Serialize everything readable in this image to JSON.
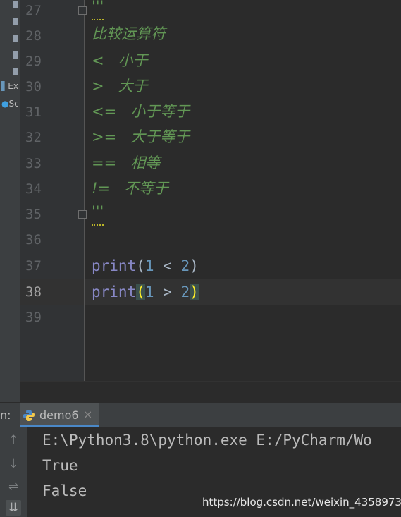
{
  "project_strip": [
    "Ex",
    "Sc"
  ],
  "line_numbers": [
    "27",
    "28",
    "29",
    "30",
    "31",
    "32",
    "33",
    "34",
    "35",
    "36",
    "37",
    "38",
    "39"
  ],
  "code": {
    "l27": "'''",
    "l28": "比较运算符",
    "l29": "<   小于",
    "l30": ">   大于",
    "l31": "<=   小于等于",
    "l32": ">=   大于等于",
    "l33": "==   相等",
    "l34": "!=   不等于",
    "l35": "'''",
    "l37": {
      "fn": "print",
      "open": "(",
      "a": "1",
      "op": " < ",
      "b": "2",
      "close": ")"
    },
    "l38": {
      "fn": "print",
      "open": "(",
      "a": "1",
      "op": " > ",
      "b": "2",
      "close": ")"
    }
  },
  "run": {
    "label": "n:",
    "tab": "demo6",
    "close": "×",
    "output": [
      "E:\\Python3.8\\python.exe E:/PyCharm/Wo",
      "True",
      "False"
    ]
  },
  "toolbar_icons": [
    "arrow-up-icon",
    "arrow-down-icon",
    "soft-wrap-icon",
    "scroll-to-end-icon"
  ],
  "watermark": "https://blog.csdn.net/weixin_43589736"
}
